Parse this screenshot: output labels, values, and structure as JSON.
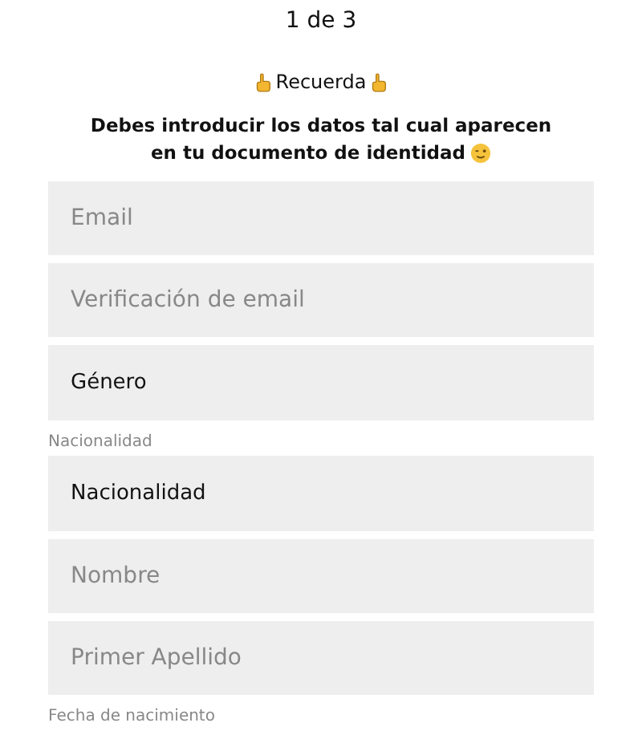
{
  "step": "1 de 3",
  "notice": {
    "title": "Recuerda",
    "message_lines": [
      "Debes introducir los datos tal cual aparecen",
      "en tu documento de identidad"
    ]
  },
  "fields": [
    {
      "kind": "input",
      "placeholder": "Email"
    },
    {
      "kind": "input",
      "placeholder": "Verificación de email"
    },
    {
      "kind": "select",
      "value": "Género"
    },
    {
      "kind": "label",
      "text": "Nacionalidad"
    },
    {
      "kind": "select",
      "value": "Nacionalidad"
    },
    {
      "kind": "input",
      "placeholder": "Nombre"
    },
    {
      "kind": "input",
      "placeholder": "Primer Apellido"
    },
    {
      "kind": "label",
      "text": "Fecha de nacimiento"
    }
  ]
}
